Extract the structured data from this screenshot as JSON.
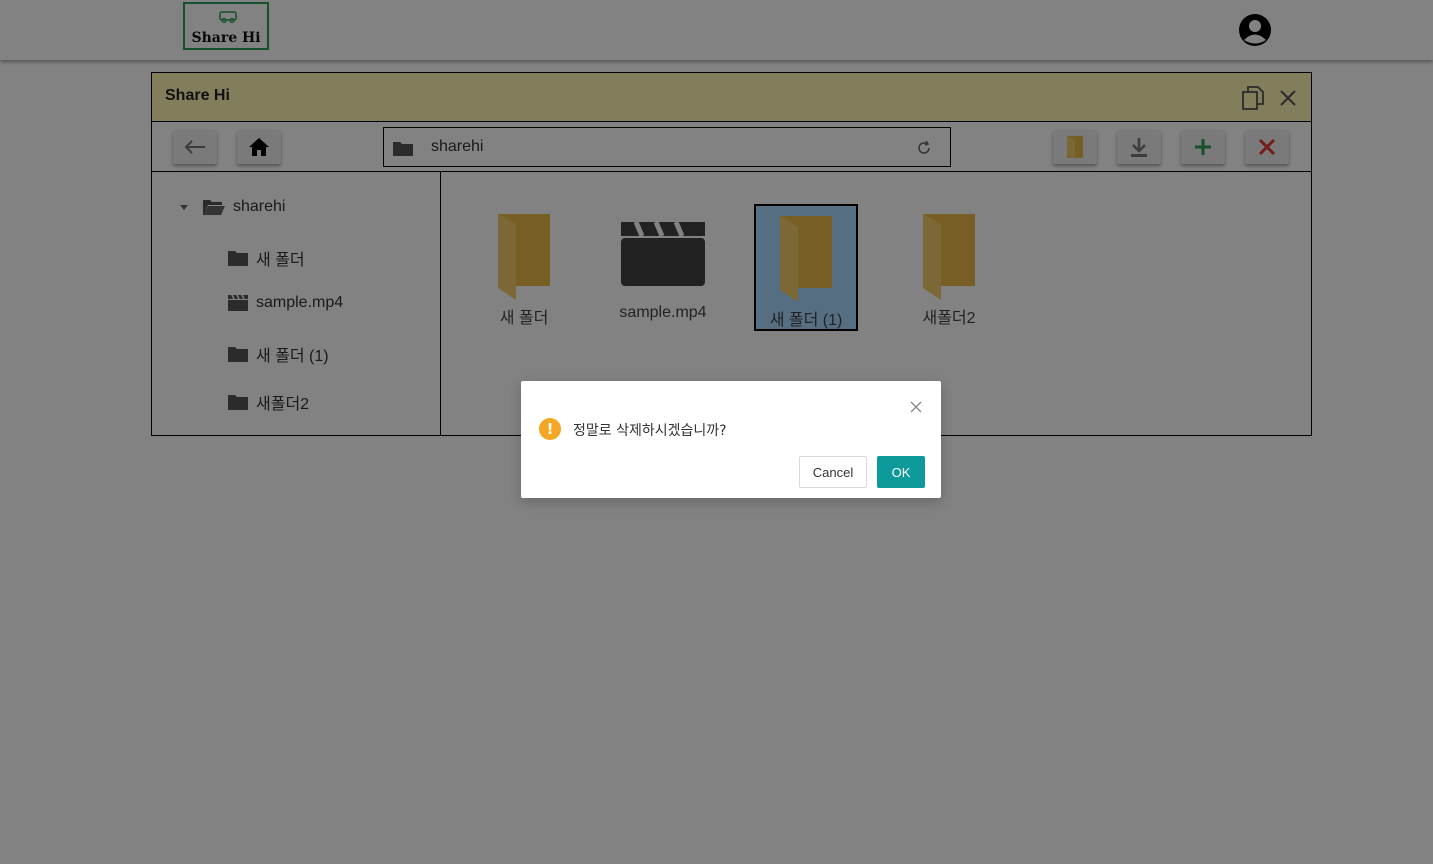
{
  "header": {
    "logo_text": "Share Hi",
    "avatar_icon": "user-circle-icon"
  },
  "window": {
    "title": "Share Hi",
    "title_bar_color": "#fff5b3",
    "copy_icon": "copy-window-icon",
    "close_icon": "close-icon"
  },
  "toolbar": {
    "back_icon": "arrow-left-icon",
    "home_icon": "home-icon",
    "address": "sharehi",
    "refresh_icon": "refresh-icon",
    "new_folder_icon": "folder-icon",
    "download_icon": "download-icon",
    "add_icon": "plus-icon",
    "delete_icon": "x-icon"
  },
  "tree": {
    "root": "sharehi",
    "items": [
      {
        "label": "새 폴더",
        "icon": "folder-icon"
      },
      {
        "label": "sample.mp4",
        "icon": "video-icon"
      },
      {
        "label": "새 폴더 (1)",
        "icon": "folder-icon"
      },
      {
        "label": "새폴더2",
        "icon": "folder-icon"
      }
    ]
  },
  "files": [
    {
      "label": "새 폴더",
      "icon": "folder-icon",
      "selected": false
    },
    {
      "label": "sample.mp4",
      "icon": "clapperboard-icon",
      "selected": false
    },
    {
      "label": "새 폴더 (1)",
      "icon": "folder-icon",
      "selected": true
    },
    {
      "label": "새폴더2",
      "icon": "folder-icon",
      "selected": false
    }
  ],
  "dialog": {
    "message": "정말로 삭제하시겠습니까?",
    "cancel_label": "Cancel",
    "ok_label": "OK",
    "ok_color": "#0e9a9a",
    "warning_color": "#f5a623"
  }
}
